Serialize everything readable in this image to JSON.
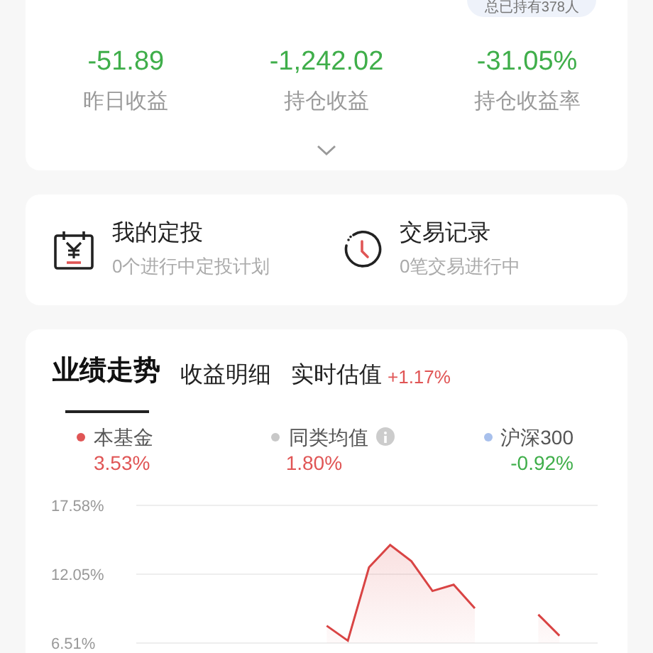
{
  "holders_badge": {
    "text": "总已持有378人"
  },
  "summary": [
    {
      "value": "-51.89",
      "label": "昨日收益"
    },
    {
      "value": "-1,242.02",
      "label": "持仓收益"
    },
    {
      "value": "-31.05%",
      "label": "持仓收益率"
    }
  ],
  "shortcuts": [
    {
      "kind": "plan",
      "title": "我的定投",
      "subtitle": "0个进行中定投计划"
    },
    {
      "kind": "history",
      "title": "交易记录",
      "subtitle": "0笔交易进行中"
    }
  ],
  "tabs": [
    {
      "label": "业绩走势",
      "selected": true
    },
    {
      "label": "收益明细",
      "selected": false
    },
    {
      "label": "实时估值",
      "selected": false,
      "badge": "+1.17%"
    }
  ],
  "legend": [
    {
      "name": "本基金",
      "color": "#e05555",
      "value": "3.53%",
      "info": false
    },
    {
      "name": "同类均值",
      "color": "#c8c8c8",
      "value": "1.80%",
      "info": true
    },
    {
      "name": "沪深300",
      "color": "#a8c0ec",
      "value": "-0.92%",
      "info": false
    }
  ],
  "chart_data": {
    "type": "area",
    "grid": true,
    "ylim": [
      6.51,
      17.58
    ],
    "series": [
      {
        "color": "#d94444",
        "values": [
          null,
          null,
          null,
          null,
          null,
          null,
          null,
          null,
          null,
          7.9,
          6.7,
          12.6,
          14.4,
          13.1,
          10.7,
          11.2,
          9.3,
          null,
          null,
          8.8,
          7.1,
          null
        ]
      }
    ],
    "yticks": [
      {
        "value": 17.58,
        "label": "17.58%"
      },
      {
        "value": 12.05,
        "label": "12.05%"
      },
      {
        "value": 6.51,
        "label": "6.51%"
      }
    ]
  }
}
